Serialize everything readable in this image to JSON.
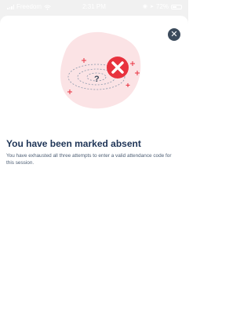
{
  "status_bar": {
    "carrier": "Freedom",
    "time": "2:31 PM",
    "battery": "72%"
  },
  "dialog": {
    "close_icon": "close-icon",
    "illustration_icon": "absent-x-illustration",
    "question_mark": "?",
    "title": "You have been marked absent",
    "message": "You have exhausted all three attempts to enter a valid attendance code for this session."
  },
  "colors": {
    "accent_red": "#e8323e",
    "title_navy": "#1f3557",
    "blob_pink": "#fbe3e5"
  }
}
